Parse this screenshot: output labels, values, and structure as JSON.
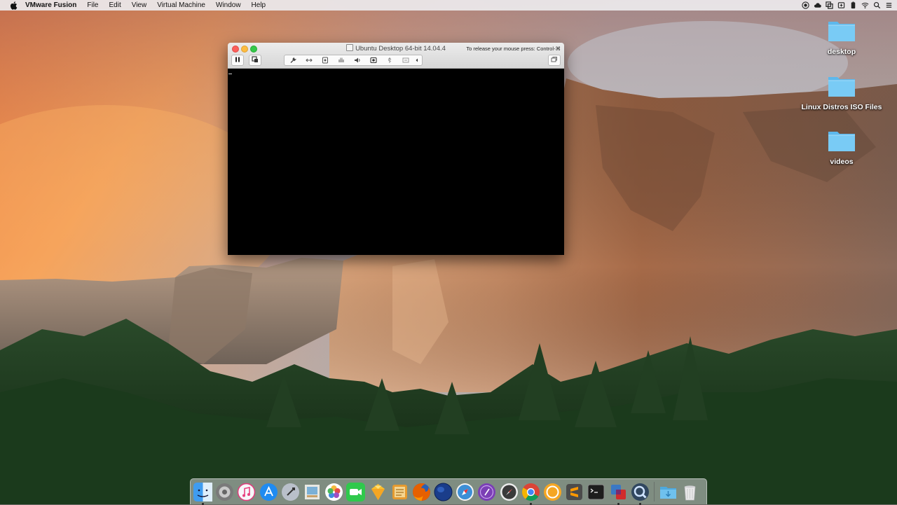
{
  "menubar": {
    "app_name": "VMware Fusion",
    "menus": [
      "File",
      "Edit",
      "View",
      "Virtual Machine",
      "Window",
      "Help"
    ],
    "status_icons": [
      "record-icon",
      "cloud-icon",
      "vmware-status-icon",
      "sync-icon",
      "battery-icon",
      "wifi-icon",
      "search-icon",
      "list-icon"
    ]
  },
  "desktop_icons": [
    {
      "label": "desktop",
      "icon": "folder-icon"
    },
    {
      "label": "Linux Distros ISO Files",
      "icon": "folder-icon"
    },
    {
      "label": "videos",
      "icon": "folder-icon"
    }
  ],
  "vm_window": {
    "title": "Ubuntu Desktop 64-bit 14.04.4",
    "release_hint": "To release your mouse press: Control-⌘",
    "toolbar_icons": [
      "pause-icon",
      "snapshot-icon",
      "wrench-icon",
      "network-arrows-icon",
      "hard-disk-icon",
      "printer-icon",
      "sound-icon",
      "camera-icon",
      "usb-icon",
      "shared-folder-icon",
      "chevron-left-icon",
      "fullscreen-icon"
    ]
  },
  "dock": {
    "apps": [
      {
        "name": "finder",
        "color": "#3f9cf0",
        "running": true
      },
      {
        "name": "system-preferences",
        "color": "#8a8a8a",
        "running": false
      },
      {
        "name": "itunes",
        "color": "#f4f4f7",
        "running": false
      },
      {
        "name": "app-store",
        "color": "#1f8bf1",
        "running": false
      },
      {
        "name": "launchpad",
        "color": "#c9ced6",
        "running": false
      },
      {
        "name": "preview",
        "color": "#e8e8e2",
        "running": false
      },
      {
        "name": "photos",
        "color": "#ffffff",
        "running": false
      },
      {
        "name": "facetime",
        "color": "#2fc94c",
        "running": false
      },
      {
        "name": "sketch",
        "color": "#fbc02d",
        "running": false
      },
      {
        "name": "ibooks",
        "color": "#e59a30",
        "running": false
      },
      {
        "name": "firefox",
        "color": "#e66000",
        "running": false
      },
      {
        "name": "browser-globe",
        "color": "#1a3d8a",
        "running": false
      },
      {
        "name": "safari",
        "color": "#3d8fd6",
        "running": false
      },
      {
        "name": "tor-browser",
        "color": "#7b3fb5",
        "running": false
      },
      {
        "name": "compass",
        "color": "#3a3a3a",
        "running": false
      },
      {
        "name": "chrome",
        "color": "#4285f4",
        "running": true
      },
      {
        "name": "ibooks-alt",
        "color": "#f5a623",
        "running": false
      },
      {
        "name": "sublime-text",
        "color": "#4b4b4b",
        "running": false
      },
      {
        "name": "terminal",
        "color": "#1d1d1d",
        "running": false
      },
      {
        "name": "vmware-fusion",
        "color": "#d12b2b",
        "running": true
      },
      {
        "name": "quicktime",
        "color": "#31475f",
        "running": true
      }
    ],
    "extras": [
      {
        "name": "downloads-folder",
        "color": "#5cb8e8"
      },
      {
        "name": "trash",
        "color": "#e9e9ea"
      }
    ]
  }
}
